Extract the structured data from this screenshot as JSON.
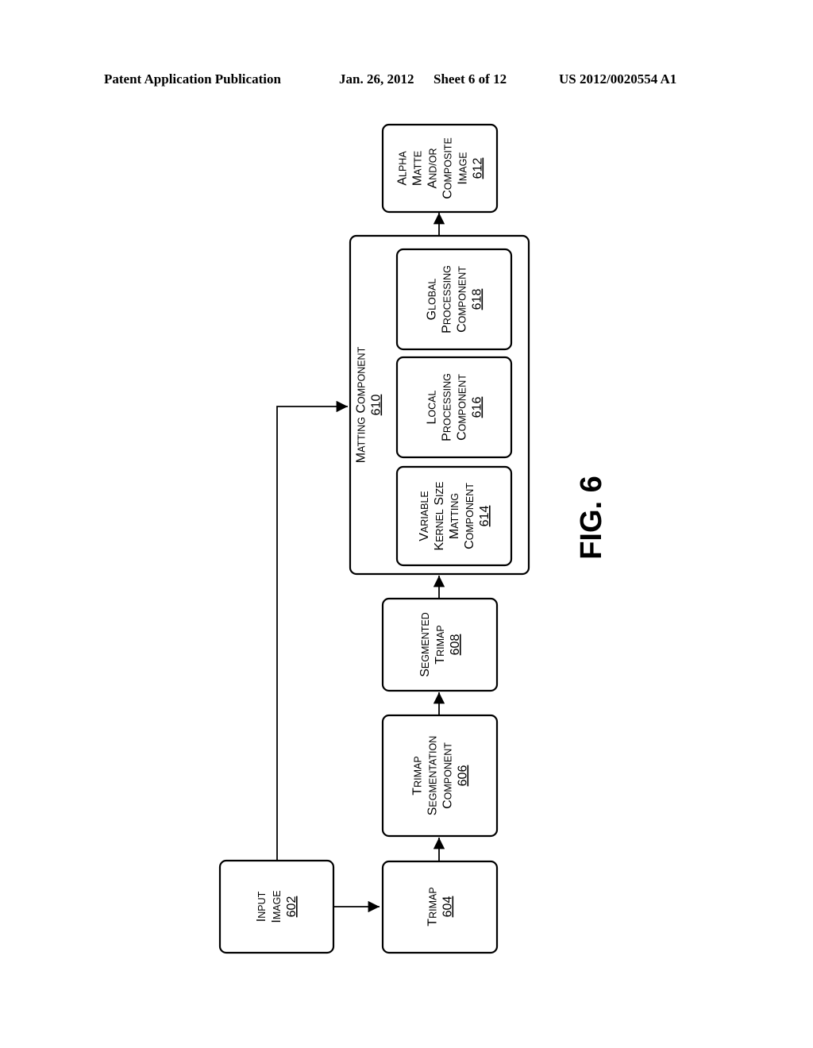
{
  "header": {
    "left": "Patent Application Publication",
    "date": "Jan. 26, 2012",
    "sheet": "Sheet 6 of 12",
    "number": "US 2012/0020554 A1"
  },
  "figure": {
    "label": "FIG. 6",
    "nodes": {
      "input_image": {
        "lines": [
          "Input",
          "Image"
        ],
        "ref": "602"
      },
      "trimap": {
        "lines": [
          "Trimap"
        ],
        "ref": "604"
      },
      "trimap_segmentation": {
        "lines": [
          "Trimap",
          "Segmentation",
          "Component"
        ],
        "ref": "606"
      },
      "segmented_trimap": {
        "lines": [
          "Segmented",
          "Trimap"
        ],
        "ref": "608"
      },
      "matting_component": {
        "lines": [
          "Matting Component"
        ],
        "ref": "610"
      },
      "variable_kernel": {
        "lines": [
          "Variable",
          "Kernel Size",
          "Matting",
          "Component"
        ],
        "ref": "614"
      },
      "local_processing": {
        "lines": [
          "Local",
          "Processing",
          "Component"
        ],
        "ref": "616"
      },
      "global_processing": {
        "lines": [
          "Global",
          "Processing",
          "Component"
        ],
        "ref": "618"
      },
      "alpha_matte": {
        "lines": [
          "Alpha",
          "Matte",
          "and/or",
          "Composite",
          "Image"
        ],
        "ref": "612"
      }
    },
    "edges": [
      [
        "input_image",
        "trimap"
      ],
      [
        "input_image",
        "matting_component"
      ],
      [
        "trimap",
        "trimap_segmentation"
      ],
      [
        "trimap_segmentation",
        "segmented_trimap"
      ],
      [
        "segmented_trimap",
        "matting_component"
      ],
      [
        "matting_component",
        "alpha_matte"
      ]
    ]
  }
}
